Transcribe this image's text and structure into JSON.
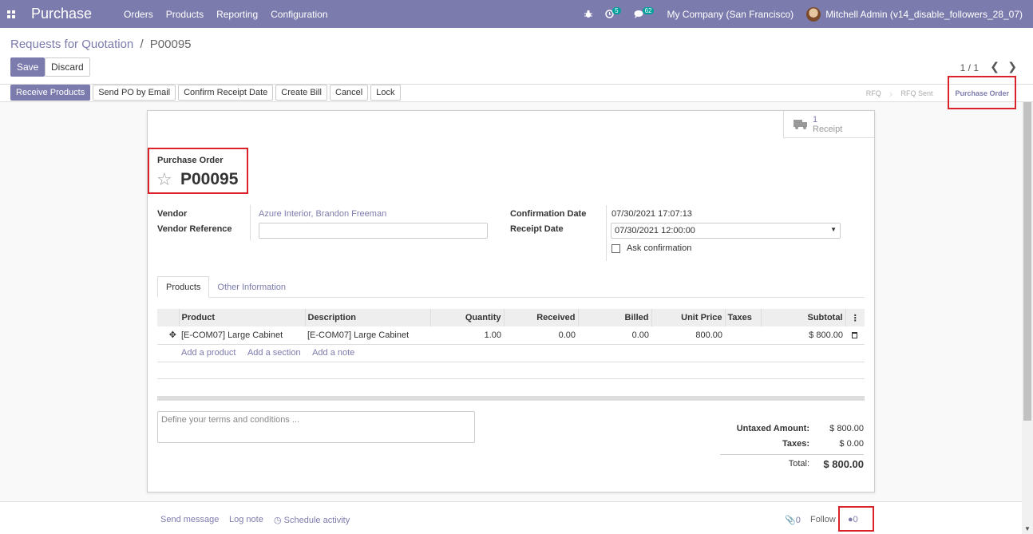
{
  "navbar": {
    "app_title": "Purchase",
    "menu": [
      "Orders",
      "Products",
      "Reporting",
      "Configuration"
    ],
    "activity_count": "5",
    "messages_count": "62",
    "company": "My Company (San Francisco)",
    "user": "Mitchell Admin (v14_disable_followers_28_07)"
  },
  "breadcrumb": {
    "parent": "Requests for Quotation",
    "separator": "/",
    "current": "P00095"
  },
  "control": {
    "save_label": "Save",
    "discard_label": "Discard",
    "pager": "1 / 1"
  },
  "statusbar": {
    "actions": [
      "Receive Products",
      "Send PO by Email",
      "Confirm Receipt Date",
      "Create Bill",
      "Cancel",
      "Lock"
    ],
    "stages": [
      "RFQ",
      "RFQ Sent",
      "Purchase Order"
    ],
    "active_stage": "Purchase Order"
  },
  "smart_button": {
    "count": "1",
    "label": "Receipt"
  },
  "form": {
    "title_label": "Purchase Order",
    "name": "P00095",
    "vendor_label": "Vendor",
    "vendor_value": "Azure Interior, Brandon Freeman",
    "vendor_ref_label": "Vendor Reference",
    "vendor_ref_value": "",
    "confirmation_date_label": "Confirmation Date",
    "confirmation_date_value": "07/30/2021 17:07:13",
    "receipt_date_label": "Receipt Date",
    "receipt_date_value": "07/30/2021 12:00:00",
    "ask_confirmation_label": "Ask confirmation"
  },
  "tabs": [
    "Products",
    "Other Information"
  ],
  "lines": {
    "headers": [
      "Product",
      "Description",
      "Quantity",
      "Received",
      "Billed",
      "Unit Price",
      "Taxes",
      "Subtotal"
    ],
    "rows": [
      {
        "product": "[E-COM07] Large Cabinet",
        "description": "[E-COM07] Large Cabinet",
        "quantity": "1.00",
        "received": "0.00",
        "billed": "0.00",
        "unit_price": "800.00",
        "taxes": "",
        "subtotal": "$ 800.00"
      }
    ],
    "add_product": "Add a product",
    "add_section": "Add a section",
    "add_note": "Add a note"
  },
  "notes_placeholder": "Define your terms and conditions ...",
  "totals": {
    "untaxed_label": "Untaxed Amount:",
    "untaxed_value": "$ 800.00",
    "taxes_label": "Taxes:",
    "taxes_value": "$ 0.00",
    "total_label": "Total:",
    "total_value": "$ 800.00"
  },
  "chatter": {
    "send_message": "Send message",
    "log_note": "Log note",
    "schedule_activity": "Schedule activity",
    "attachments": "0",
    "follow": "Follow",
    "followers": "0"
  },
  "icons": {
    "apps": "apps-grid-icon",
    "bug": "bug-icon",
    "activity": "clock-icon",
    "messages": "chat-icon",
    "star": "star-icon",
    "truck": "truck-icon",
    "trash": "trash-icon",
    "drag": "drag-handle-icon"
  },
  "colors": {
    "brand": "#7c7bad",
    "badge": "#00a09d",
    "highlight": "#d9222a"
  }
}
